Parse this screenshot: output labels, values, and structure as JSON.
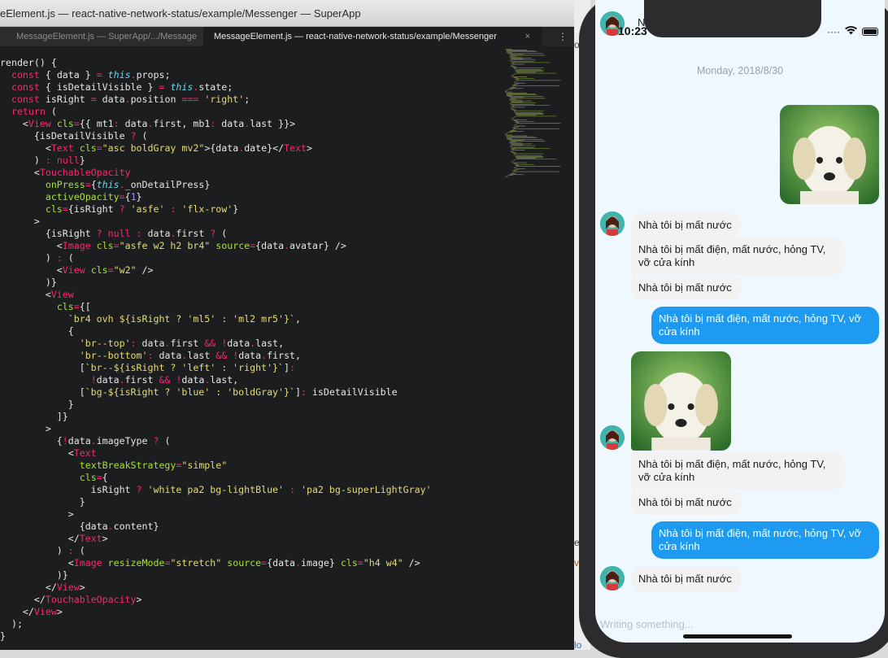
{
  "editor": {
    "window_title": "eElement.js — react-native-network-status/example/Messenger — SuperApp",
    "tabs": [
      {
        "label": "MessageElement.js — SuperApp/.../Message"
      },
      {
        "label": "MessageElement.js — react-native-network-status/example/Messenger",
        "close": "×"
      }
    ],
    "more": "⋮",
    "code_lines": [
      "render() {",
      "  const { data } = this.props;",
      "  const { isDetailVisible } = this.state;",
      "  const isRight = data.position === 'right';",
      "  return (",
      "    <View cls={{ mt1: data.first, mb1: data.last }}>",
      "      {isDetailVisible ? (",
      "        <Text cls=\"asc boldGray mv2\">{data.date}</Text>",
      "      ) : null}",
      "      <TouchableOpacity",
      "        onPress={this._onDetailPress}",
      "        activeOpacity={1}",
      "        cls={isRight ? 'asfe' : 'flx-row'}",
      "      >",
      "        {isRight ? null : data.first ? (",
      "          <Image cls=\"asfe w2 h2 br4\" source={data.avatar} />",
      "        ) : (",
      "          <View cls=\"w2\" />",
      "        )}",
      "        <View",
      "          cls={[",
      "            `br4 ovh ${isRight ? 'ml5' : 'ml2 mr5'}`,",
      "            {",
      "              'br--top': data.first && !data.last,",
      "              'br--bottom': data.last && !data.first,",
      "              [`br--${isRight ? 'left' : 'right'}`]:",
      "                !data.first && !data.last,",
      "              [`bg-${isRight ? 'blue' : 'boldGray'}`]: isDetailVisible",
      "            }",
      "          ]}",
      "        >",
      "          {!data.imageType ? (",
      "            <Text",
      "              textBreakStrategy=\"simple\"",
      "              cls={",
      "                isRight ? 'white pa2 bg-lightBlue' : 'pa2 bg-superLightGray'",
      "              }",
      "            >",
      "              {data.content}",
      "            </Text>",
      "          ) : (",
      "            <Image resizeMode=\"stretch\" source={data.image} cls=\"h4 w4\" />",
      "          )}",
      "        </View>",
      "      </TouchableOpacity>",
      "    </View>",
      "  );",
      "}"
    ]
  },
  "background_window": {
    "fragments": [
      "ot",
      "e",
      "v.",
      "lo"
    ]
  },
  "simulator": {
    "status": {
      "time": "10:23",
      "back_label": "Nhà"
    },
    "date_label": "Monday, 2018/8/30",
    "messages": [
      {
        "side": "left",
        "text": "Nhà tôi bị mất nước"
      },
      {
        "side": "left",
        "text": "Nhà tôi bị mất điện, mất nước, hỏng TV, vỡ cửa kính"
      },
      {
        "side": "left",
        "text": "Nhà tôi bị mất nước"
      },
      {
        "side": "right",
        "text": "Nhà tôi bị mất điện, mất nước, hỏng TV, vỡ cửa kính"
      },
      {
        "side": "left",
        "text": "Nhà tôi bị mất điện, mất nước, hỏng TV, vỡ cửa kính"
      },
      {
        "side": "left",
        "text": "Nhà tôi bị mất nước"
      },
      {
        "side": "right",
        "text": "Nhà tôi bị mất điện, mất nước, hỏng TV, vỡ cửa kính"
      },
      {
        "side": "left",
        "text": "Nhà tôi bị mất nước"
      }
    ],
    "input_placeholder": "Writing something...",
    "colors": {
      "bubble_right": "#1e9bf0",
      "bubble_left": "#f2f2f2",
      "screen_bg": "#f0f8ff"
    }
  }
}
